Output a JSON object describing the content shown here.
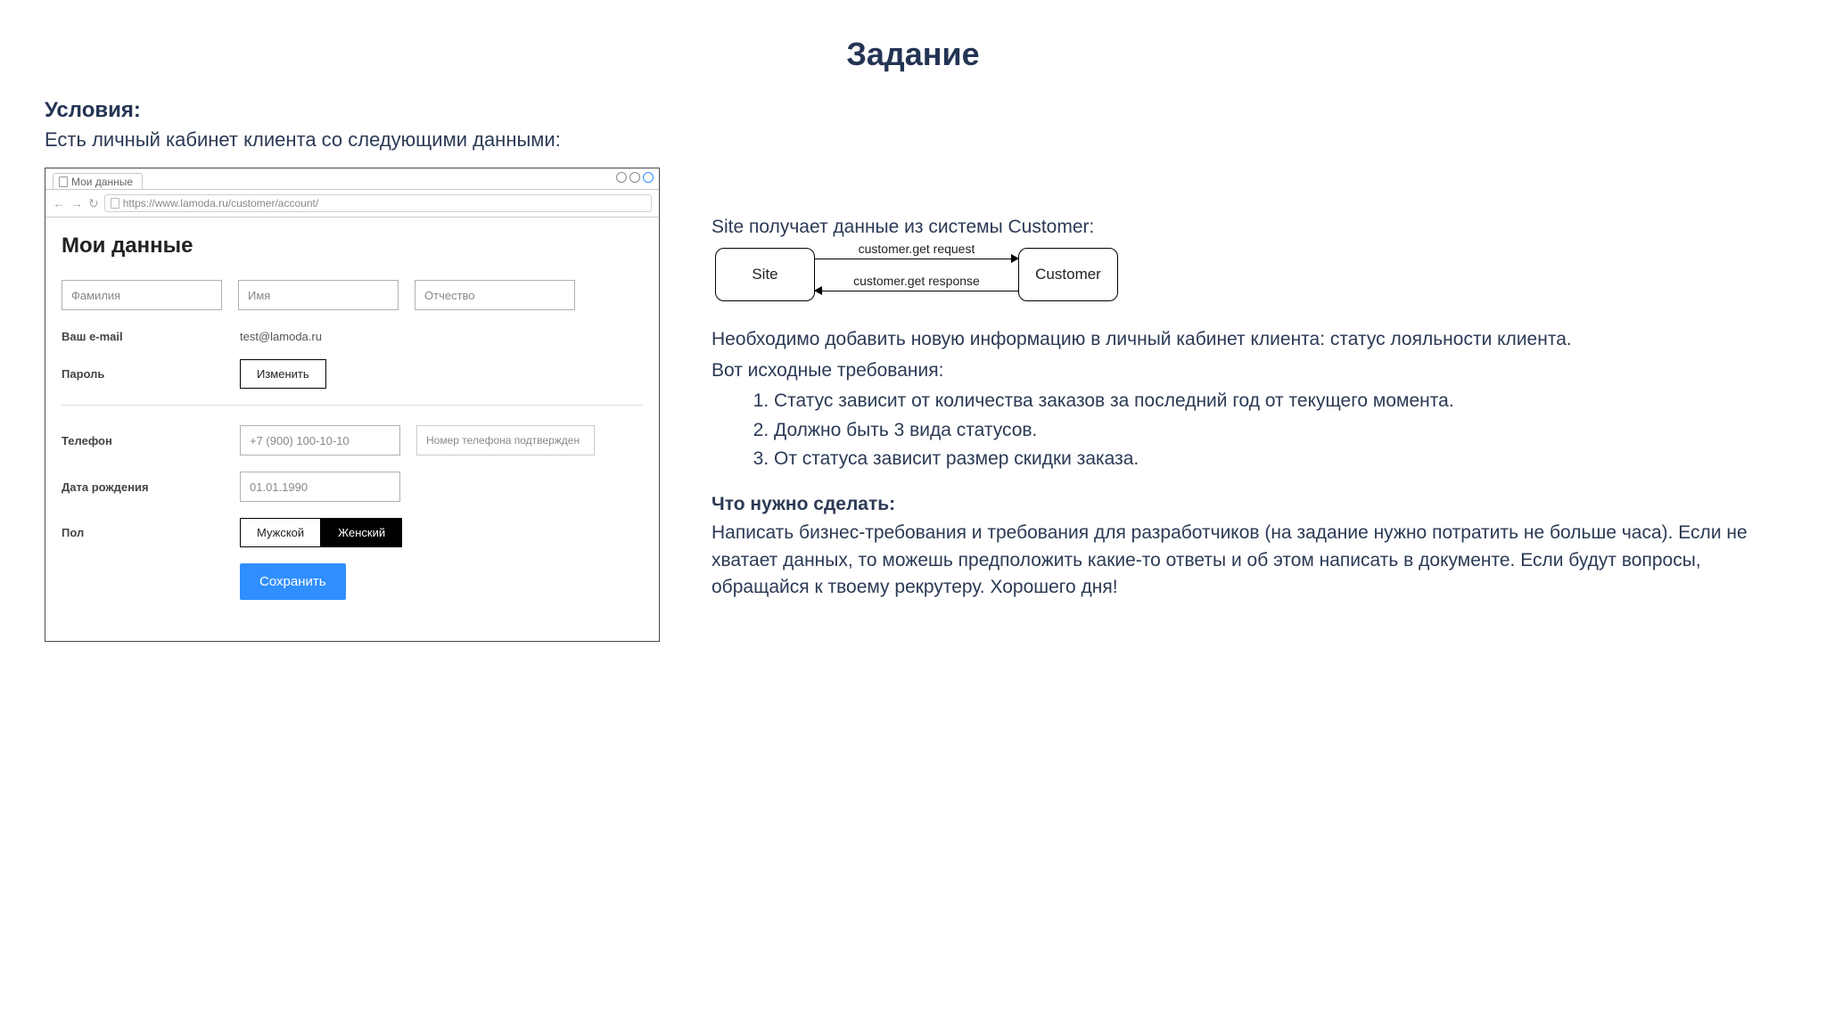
{
  "title": "Задание",
  "conditions": {
    "heading": "Условия:",
    "sub": "Есть личный кабинет клиента со следующими данными:"
  },
  "browser": {
    "tab_label": "Мои данные",
    "url": "https://www.lamoda.ru/customer/account/"
  },
  "form": {
    "title": "Мои данные",
    "lastname_ph": "Фамилия",
    "firstname_ph": "Имя",
    "patronymic_ph": "Отчество",
    "email_label": "Ваш e-mail",
    "email_value": "test@lamoda.ru",
    "password_label": "Пароль",
    "change_btn": "Изменить",
    "phone_label": "Телефон",
    "phone_value": "+7 (900) 100-10-10",
    "phone_status": "Номер телефона подтвержден",
    "dob_label": "Дата рождения",
    "dob_value": "01.01.1990",
    "gender_label": "Пол",
    "gender_male": "Мужской",
    "gender_female": "Женский",
    "save_btn": "Сохранить"
  },
  "diagram": {
    "caption": "Site получает данные из системы Customer:",
    "site_label": "Site",
    "customer_label": "Customer",
    "req_label": "customer.get request",
    "resp_label": "customer.get response"
  },
  "task": {
    "need_add": "Необходимо добавить новую информацию в личный кабинет клиента: статус лояльности клиента.",
    "req_intro": "Вот исходные требования:",
    "reqs": [
      "Статус зависит от количества заказов за последний год от текущего момента.",
      "Должно быть 3 вида статусов.",
      "От статуса зависит размер скидки заказа."
    ],
    "todo_heading": "Что нужно сделать:",
    "todo_body": "Написать бизнес-требования и требования для разработчиков (на задание нужно потратить не больше часа). Если не хватает данных, то можешь предположить какие-то ответы и об этом написать в документе. Если будут вопросы, обращайся к твоему рекрутеру. Хорошего дня!"
  }
}
